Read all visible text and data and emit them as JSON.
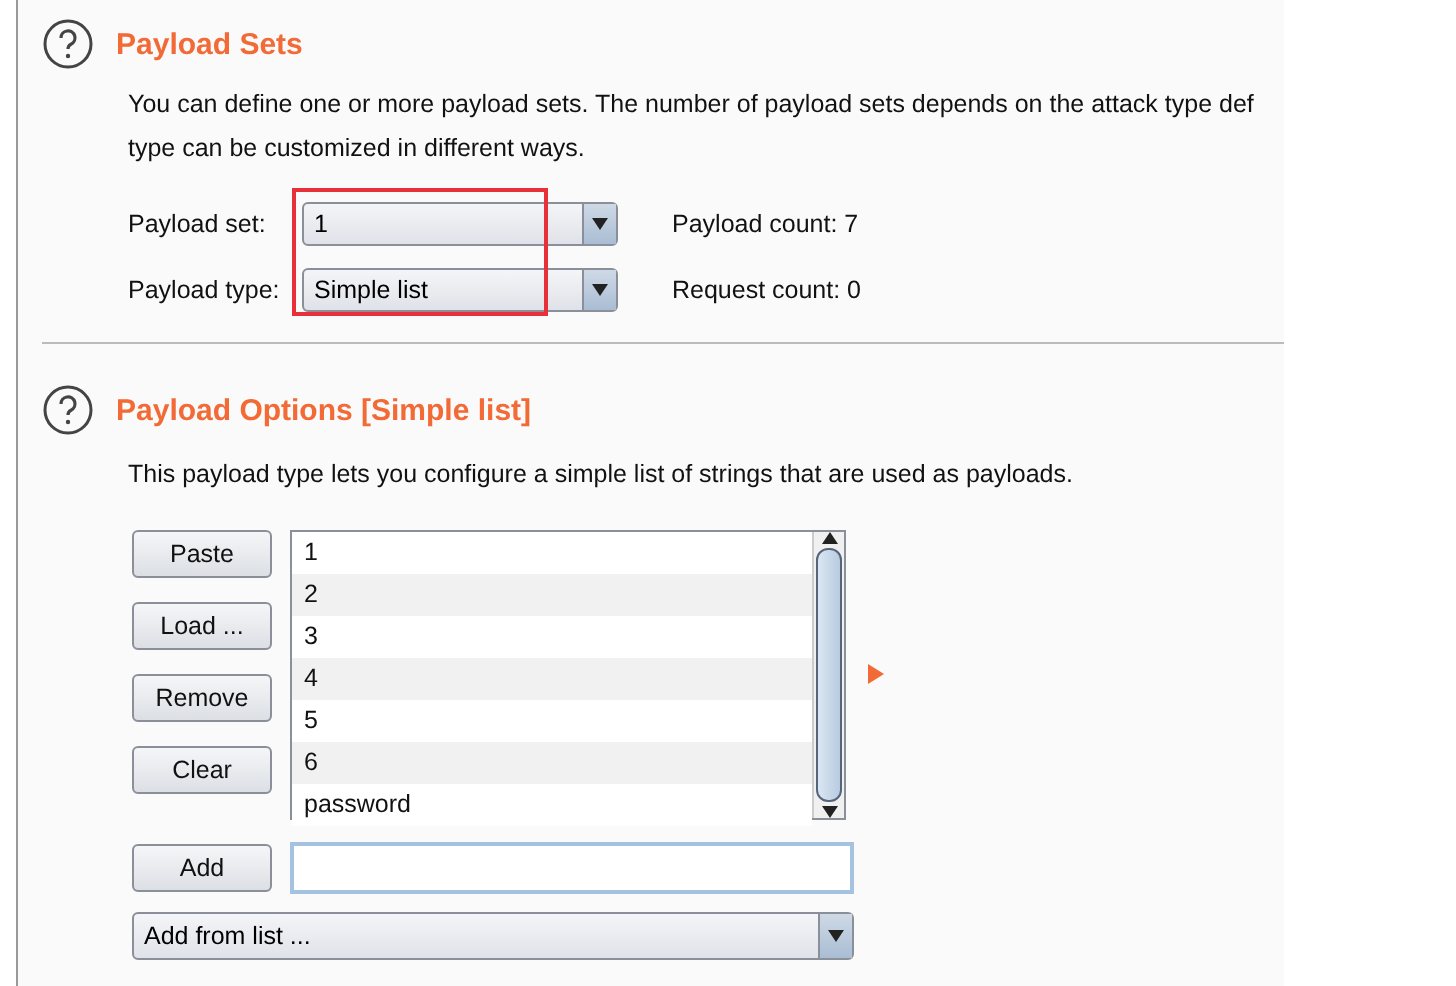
{
  "payload_sets": {
    "title": "Payload Sets",
    "description": "You can define one or more payload sets. The number of payload sets depends on the attack type def",
    "description_line_2": "type can be customized in different ways.",
    "fields": [
      {
        "label": "Payload set:",
        "value": "1",
        "count": "Payload count: 7"
      },
      {
        "label": "Payload type:",
        "value": "Simple list",
        "count": "Request count: 0"
      }
    ],
    "highlighted": true
  },
  "payload_options": {
    "title": "Payload Options [Simple list]",
    "description": "This payload type lets you configure a simple list of strings that are used as payloads.",
    "buttons": [
      "Paste",
      "Load ...",
      "Remove",
      "Clear"
    ],
    "items": [
      "1",
      "2",
      "3",
      "4",
      "5",
      "6",
      "password"
    ],
    "add_button": "Add",
    "add_from_list": "Add from list ..."
  }
}
